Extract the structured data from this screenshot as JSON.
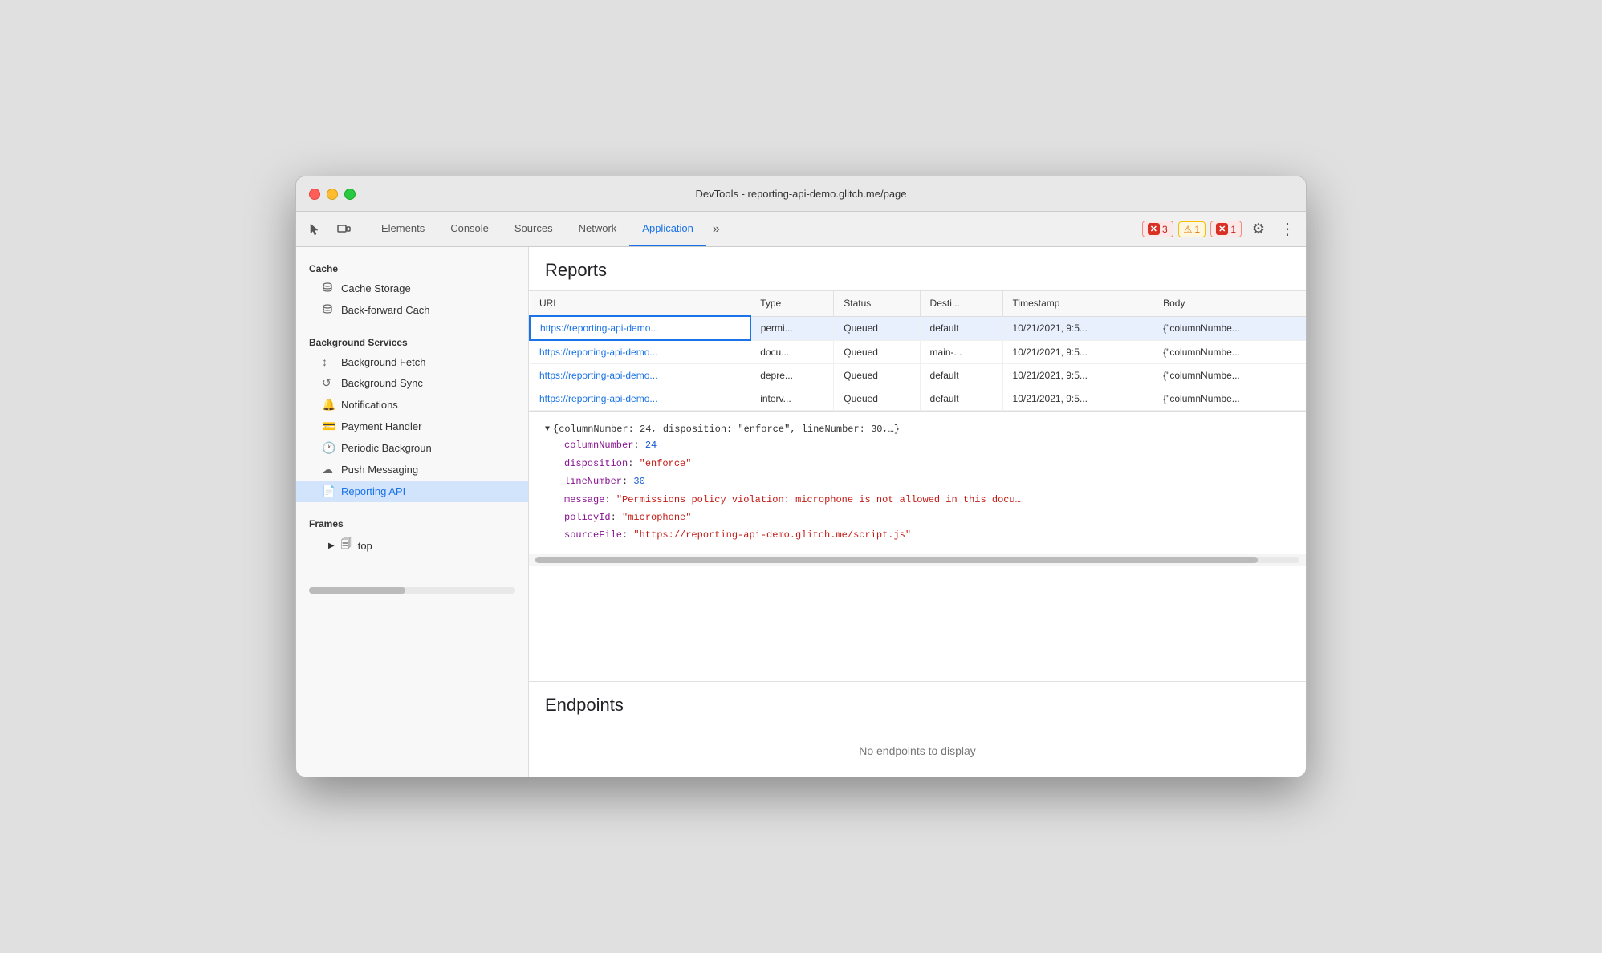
{
  "window": {
    "title": "DevTools - reporting-api-demo.glitch.me/page"
  },
  "toolbar": {
    "tabs": [
      {
        "label": "Elements",
        "active": false
      },
      {
        "label": "Console",
        "active": false
      },
      {
        "label": "Sources",
        "active": false
      },
      {
        "label": "Network",
        "active": false
      },
      {
        "label": "Application",
        "active": true
      }
    ],
    "more_label": "»",
    "error_count": "3",
    "warning_count": "1",
    "error_count2": "1",
    "error_icon": "✕",
    "warning_icon": "⚠",
    "gear_icon": "⚙",
    "more_icon": "⋮"
  },
  "sidebar": {
    "cache_section": "Cache",
    "cache_items": [
      {
        "label": "Cache Storage",
        "icon": "🗄"
      },
      {
        "label": "Back-forward Cach",
        "icon": "🗄"
      }
    ],
    "bg_services_section": "Background Services",
    "bg_items": [
      {
        "label": "Background Fetch",
        "icon": "↕"
      },
      {
        "label": "Background Sync",
        "icon": "↺"
      },
      {
        "label": "Notifications",
        "icon": "🔔"
      },
      {
        "label": "Payment Handler",
        "icon": "💳"
      },
      {
        "label": "Periodic Backgroun",
        "icon": "🕐"
      },
      {
        "label": "Push Messaging",
        "icon": "☁"
      },
      {
        "label": "Reporting API",
        "icon": "📄",
        "active": true
      }
    ],
    "frames_section": "Frames",
    "frames_items": [
      {
        "label": "top",
        "icon": "▶",
        "folder_icon": "🗐"
      }
    ]
  },
  "reports": {
    "title": "Reports",
    "columns": [
      "URL",
      "Type",
      "Status",
      "Desti...",
      "Timestamp",
      "Body"
    ],
    "rows": [
      {
        "url": "https://reporting-api-demo...",
        "type": "permi...",
        "status": "Queued",
        "dest": "default",
        "timestamp": "10/21/2021, 9:5...",
        "body": "{\"columnNumbe...",
        "selected": true
      },
      {
        "url": "https://reporting-api-demo...",
        "type": "docu...",
        "status": "Queued",
        "dest": "main-...",
        "timestamp": "10/21/2021, 9:5...",
        "body": "{\"columnNumbe...",
        "selected": false
      },
      {
        "url": "https://reporting-api-demo...",
        "type": "depre...",
        "status": "Queued",
        "dest": "default",
        "timestamp": "10/21/2021, 9:5...",
        "body": "{\"columnNumbe...",
        "selected": false
      },
      {
        "url": "https://reporting-api-demo...",
        "type": "interv...",
        "status": "Queued",
        "dest": "default",
        "timestamp": "10/21/2021, 9:5...",
        "body": "{\"columnNumbe...",
        "selected": false
      }
    ],
    "detail": {
      "summary": "{columnNumber: 24, disposition: \"enforce\", lineNumber: 30,…}",
      "props": [
        {
          "name": "columnNumber",
          "colon": ": ",
          "value": "24",
          "type": "num"
        },
        {
          "name": "disposition",
          "colon": ": ",
          "value": "\"enforce\"",
          "type": "str"
        },
        {
          "name": "lineNumber",
          "colon": ": ",
          "value": "30",
          "type": "num"
        },
        {
          "name": "message",
          "colon": ": ",
          "value": "\"Permissions policy violation: microphone is not allowed in this docu…",
          "type": "str"
        },
        {
          "name": "policyId",
          "colon": ": ",
          "value": "\"microphone\"",
          "type": "str"
        },
        {
          "name": "sourceFile",
          "colon": ": ",
          "value": "\"https://reporting-api-demo.glitch.me/script.js\"",
          "type": "str"
        }
      ]
    }
  },
  "endpoints": {
    "title": "Endpoints",
    "no_data": "No endpoints to display"
  }
}
